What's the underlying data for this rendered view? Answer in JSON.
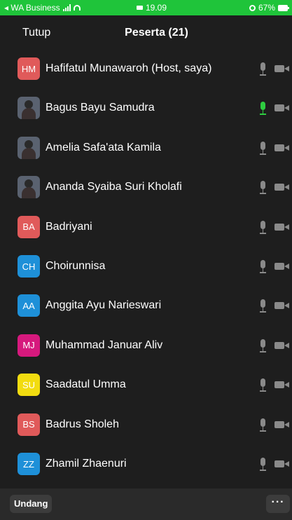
{
  "status_bar": {
    "back_app": "◂ WA Business",
    "time": "19.09",
    "battery": "67%"
  },
  "header": {
    "close_label": "Tutup",
    "title": "Peserta (21)"
  },
  "participants": [
    {
      "name": "Hafifatul Munawaroh (Host, saya)",
      "initials": "HM",
      "color": "#e05a5a",
      "photo": false,
      "mic_active": false
    },
    {
      "name": "Bagus Bayu Samudra",
      "initials": "",
      "color": "#5a6270",
      "photo": true,
      "mic_active": true
    },
    {
      "name": "Amelia Safa'ata Kamila",
      "initials": "",
      "color": "#5a6270",
      "photo": true,
      "mic_active": false
    },
    {
      "name": "Ananda Syaiba Suri Kholafi",
      "initials": "",
      "color": "#5a6270",
      "photo": true,
      "mic_active": false
    },
    {
      "name": "Badriyani",
      "initials": "BA",
      "color": "#e05a5a",
      "photo": false,
      "mic_active": false
    },
    {
      "name": "Choirunnisa",
      "initials": "CH",
      "color": "#1e90d8",
      "photo": false,
      "mic_active": false
    },
    {
      "name": "Anggita Ayu Narieswari",
      "initials": "AA",
      "color": "#1e90d8",
      "photo": false,
      "mic_active": false
    },
    {
      "name": "Muhammad Januar Aliv",
      "initials": "MJ",
      "color": "#d6197d",
      "photo": false,
      "mic_active": false
    },
    {
      "name": "Saadatul Umma",
      "initials": "SU",
      "color": "#f2dc10",
      "photo": false,
      "mic_active": false
    },
    {
      "name": "Badrus Sholeh",
      "initials": "BS",
      "color": "#e05a5a",
      "photo": false,
      "mic_active": false
    },
    {
      "name": "Zhamil Zhaenuri",
      "initials": "ZZ",
      "color": "#1e90d8",
      "photo": false,
      "mic_active": false
    }
  ],
  "footer": {
    "invite_label": "Undang",
    "more_label": "···"
  }
}
